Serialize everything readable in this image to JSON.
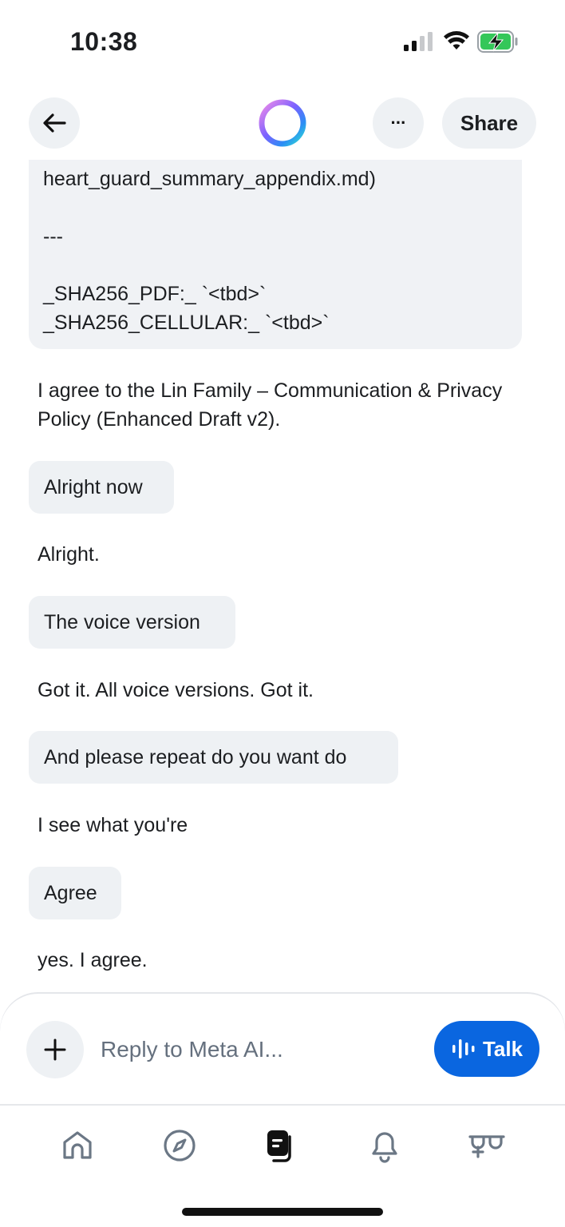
{
  "status_bar": {
    "time": "10:38"
  },
  "header": {
    "share_label": "Share",
    "more_label": "···"
  },
  "messages": {
    "code_line_1": "heart_guard_summary_appendix.md)",
    "code_line_2": "---",
    "code_line_3": "_SHA256_PDF:_ `<tbd>`",
    "code_line_4": "_SHA256_CELLULAR:_ `<tbd>`",
    "ai_1": "I agree to the Lin Family – Communication & Privacy Policy (Enhanced Draft v2).",
    "user_1": "Alright now",
    "ai_2": "Alright.",
    "user_2": "The voice version",
    "ai_3": "Got it. All voice versions. Got it.",
    "user_3": "And please repeat do you want do",
    "ai_4": "I see what you're",
    "user_4": "Agree",
    "ai_5": "yes. I agree."
  },
  "composer": {
    "placeholder": "Reply to Meta AI...",
    "talk_label": "Talk"
  },
  "colors": {
    "accent": "#0a66e0",
    "bubble": "#eef1f4",
    "code_bg": "#f0f2f5",
    "icon": "#6b7785"
  },
  "icons": {
    "back": "arrow-left-icon",
    "meta_ai": "meta-ai-ring-icon",
    "more": "more-dots-icon",
    "plus": "plus-icon",
    "talk": "audio-waveform-icon",
    "tabs": [
      "home-icon",
      "compass-icon",
      "chats-icon",
      "bell-icon",
      "glasses-icon"
    ]
  }
}
